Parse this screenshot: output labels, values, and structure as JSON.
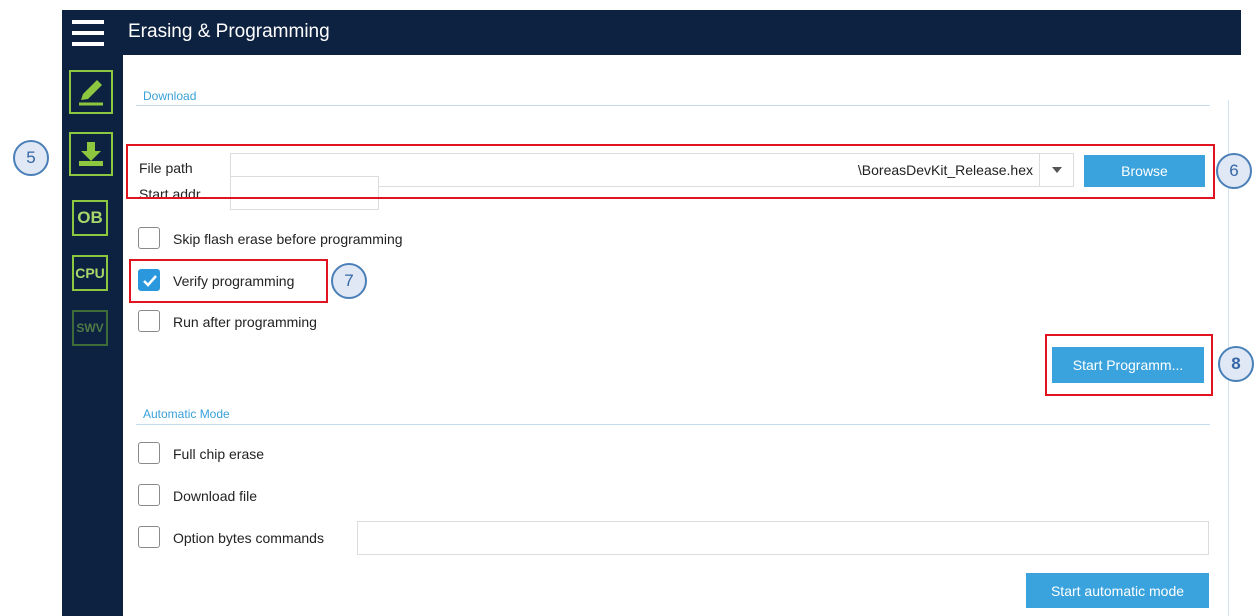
{
  "header": {
    "title": "Erasing & Programming"
  },
  "sidebar": {
    "items": [
      {
        "name": "edit",
        "label": ""
      },
      {
        "name": "download",
        "label": ""
      },
      {
        "name": "option-bytes",
        "label": "OB"
      },
      {
        "name": "cpu",
        "label": "CPU"
      },
      {
        "name": "swv",
        "label": "SWV"
      }
    ]
  },
  "download": {
    "section_title": "Download",
    "file_path_label": "File path",
    "file_path_value": "\\BoreasDevKit_Release.hex",
    "browse_label": "Browse",
    "start_addr_label": "Start addr...",
    "start_addr_value": "",
    "skip_erase_label": "Skip flash erase before programming",
    "skip_erase_checked": false,
    "verify_label": "Verify programming",
    "verify_checked": true,
    "run_after_label": "Run after programming",
    "run_after_checked": false,
    "start_programming_label": "Start Programm..."
  },
  "automatic": {
    "section_title": "Automatic Mode",
    "full_chip_erase_label": "Full chip erase",
    "download_file_label": "Download file",
    "option_bytes_label": "Option bytes commands",
    "option_bytes_value": "",
    "start_auto_label": "Start automatic mode"
  },
  "callouts": {
    "c5": "5",
    "c6": "6",
    "c7": "7",
    "c8": "8"
  },
  "colors": {
    "header_bg": "#0d2140",
    "accent_blue": "#3aa3dd",
    "icon_green": "#8dc63f",
    "highlight_red": "#e0141e"
  }
}
